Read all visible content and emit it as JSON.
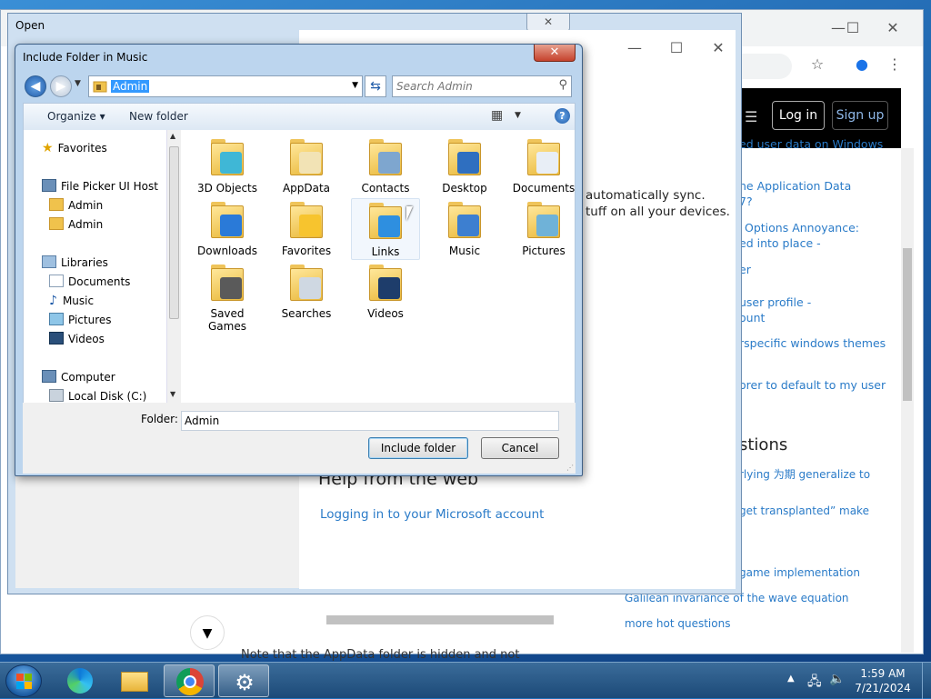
{
  "browser": {
    "header": {
      "login": "Log in",
      "signup": "Sign up"
    },
    "side_links": [
      "ed user data on Windows",
      "he Application Data",
      "7?",
      "Options Annoyance:",
      "ed into place -",
      "er",
      "user profile -",
      "ount",
      "rspecific windows themes",
      "orer to default to my user"
    ],
    "related_heading": "stions",
    "hot_questions": [
      "rlying 为期 generalize to",
      "get transplanted” make",
      "game implementation",
      "Galilean invariance of the wave equation",
      "more hot questions"
    ],
    "note_text": "Note that the  AppData  folder is hidden and not"
  },
  "open_dialog": {
    "title": "Open",
    "close_label": "✕",
    "sync_text_line1": "automatically sync.",
    "sync_text_line2": "tuff on all your devices.",
    "help_heading": "Help from the web",
    "help_link": "Logging in to your Microsoft account"
  },
  "include_dialog": {
    "title": "Include Folder in Music",
    "close_label": "✕",
    "path": "Admin",
    "search_placeholder": "Search Admin",
    "toolbar": {
      "organize": "Organize ▾",
      "new_folder": "New folder"
    },
    "nav": [
      {
        "label": "Favorites",
        "icon": "star-icon"
      },
      {
        "label": "File Picker UI Host",
        "icon": "computer-icon"
      },
      {
        "label": "Admin",
        "icon": "user-folder-icon"
      },
      {
        "label": "Admin",
        "icon": "user-folder-icon"
      },
      {
        "label": "Libraries",
        "icon": "libraries-icon"
      },
      {
        "label": "Documents",
        "icon": "documents-icon"
      },
      {
        "label": "Music",
        "icon": "music-icon"
      },
      {
        "label": "Pictures",
        "icon": "pictures-icon"
      },
      {
        "label": "Videos",
        "icon": "videos-icon"
      },
      {
        "label": "Computer",
        "icon": "computer-icon"
      },
      {
        "label": "Local Disk (C:)",
        "icon": "disk-icon"
      }
    ],
    "files": [
      {
        "label": "3D Objects",
        "icon": "3d-objects-folder-icon",
        "overlay": "#3fb7d6"
      },
      {
        "label": "AppData",
        "icon": "appdata-folder-icon",
        "overlay": "#f2e3b5"
      },
      {
        "label": "Contacts",
        "icon": "contacts-folder-icon",
        "overlay": "#7ea6cf"
      },
      {
        "label": "Desktop",
        "icon": "desktop-folder-icon",
        "overlay": "#2f6fc0"
      },
      {
        "label": "Documents",
        "icon": "documents-folder-icon",
        "overlay": "#e8eef6"
      },
      {
        "label": "Downloads",
        "icon": "downloads-folder-icon",
        "overlay": "#2a7ad8"
      },
      {
        "label": "Favorites",
        "icon": "favorites-folder-icon",
        "overlay": "#f7c42e"
      },
      {
        "label": "Links",
        "icon": "links-folder-icon",
        "overlay": "#2e8fe0"
      },
      {
        "label": "Music",
        "icon": "music-folder-icon",
        "overlay": "#3d7fd0"
      },
      {
        "label": "Pictures",
        "icon": "pictures-folder-icon",
        "overlay": "#6fb2d8"
      },
      {
        "label": "Saved Games",
        "icon": "saved-games-folder-icon",
        "overlay": "#5a5a5a"
      },
      {
        "label": "Searches",
        "icon": "searches-folder-icon",
        "overlay": "#cfd8e2"
      },
      {
        "label": "Videos",
        "icon": "videos-folder-icon",
        "overlay": "#1e3d6b"
      }
    ],
    "folder_label": "Folder:",
    "folder_value": "Admin",
    "include_button": "Include folder",
    "cancel_button": "Cancel"
  },
  "taskbar": {
    "time": "1:59 AM",
    "date": "7/21/2024",
    "apps": [
      "start-icon",
      "edge-icon",
      "file-explorer-icon",
      "chrome-icon",
      "settings-icon"
    ]
  }
}
